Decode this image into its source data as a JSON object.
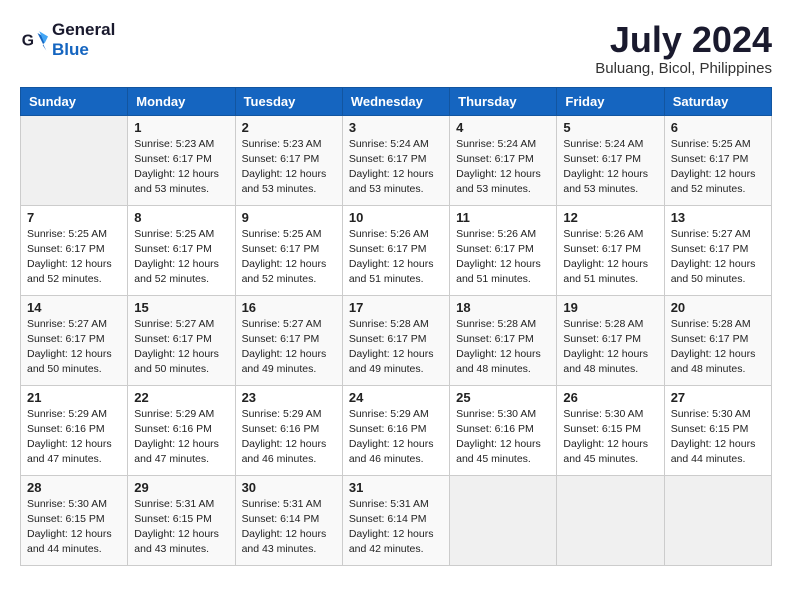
{
  "logo": {
    "line1": "General",
    "line2": "Blue"
  },
  "title": "July 2024",
  "location": "Buluang, Bicol, Philippines",
  "days_of_week": [
    "Sunday",
    "Monday",
    "Tuesday",
    "Wednesday",
    "Thursday",
    "Friday",
    "Saturday"
  ],
  "weeks": [
    [
      {
        "day": "",
        "info": ""
      },
      {
        "day": "1",
        "info": "Sunrise: 5:23 AM\nSunset: 6:17 PM\nDaylight: 12 hours\nand 53 minutes."
      },
      {
        "day": "2",
        "info": "Sunrise: 5:23 AM\nSunset: 6:17 PM\nDaylight: 12 hours\nand 53 minutes."
      },
      {
        "day": "3",
        "info": "Sunrise: 5:24 AM\nSunset: 6:17 PM\nDaylight: 12 hours\nand 53 minutes."
      },
      {
        "day": "4",
        "info": "Sunrise: 5:24 AM\nSunset: 6:17 PM\nDaylight: 12 hours\nand 53 minutes."
      },
      {
        "day": "5",
        "info": "Sunrise: 5:24 AM\nSunset: 6:17 PM\nDaylight: 12 hours\nand 53 minutes."
      },
      {
        "day": "6",
        "info": "Sunrise: 5:25 AM\nSunset: 6:17 PM\nDaylight: 12 hours\nand 52 minutes."
      }
    ],
    [
      {
        "day": "7",
        "info": "Sunrise: 5:25 AM\nSunset: 6:17 PM\nDaylight: 12 hours\nand 52 minutes."
      },
      {
        "day": "8",
        "info": "Sunrise: 5:25 AM\nSunset: 6:17 PM\nDaylight: 12 hours\nand 52 minutes."
      },
      {
        "day": "9",
        "info": "Sunrise: 5:25 AM\nSunset: 6:17 PM\nDaylight: 12 hours\nand 52 minutes."
      },
      {
        "day": "10",
        "info": "Sunrise: 5:26 AM\nSunset: 6:17 PM\nDaylight: 12 hours\nand 51 minutes."
      },
      {
        "day": "11",
        "info": "Sunrise: 5:26 AM\nSunset: 6:17 PM\nDaylight: 12 hours\nand 51 minutes."
      },
      {
        "day": "12",
        "info": "Sunrise: 5:26 AM\nSunset: 6:17 PM\nDaylight: 12 hours\nand 51 minutes."
      },
      {
        "day": "13",
        "info": "Sunrise: 5:27 AM\nSunset: 6:17 PM\nDaylight: 12 hours\nand 50 minutes."
      }
    ],
    [
      {
        "day": "14",
        "info": "Sunrise: 5:27 AM\nSunset: 6:17 PM\nDaylight: 12 hours\nand 50 minutes."
      },
      {
        "day": "15",
        "info": "Sunrise: 5:27 AM\nSunset: 6:17 PM\nDaylight: 12 hours\nand 50 minutes."
      },
      {
        "day": "16",
        "info": "Sunrise: 5:27 AM\nSunset: 6:17 PM\nDaylight: 12 hours\nand 49 minutes."
      },
      {
        "day": "17",
        "info": "Sunrise: 5:28 AM\nSunset: 6:17 PM\nDaylight: 12 hours\nand 49 minutes."
      },
      {
        "day": "18",
        "info": "Sunrise: 5:28 AM\nSunset: 6:17 PM\nDaylight: 12 hours\nand 48 minutes."
      },
      {
        "day": "19",
        "info": "Sunrise: 5:28 AM\nSunset: 6:17 PM\nDaylight: 12 hours\nand 48 minutes."
      },
      {
        "day": "20",
        "info": "Sunrise: 5:28 AM\nSunset: 6:17 PM\nDaylight: 12 hours\nand 48 minutes."
      }
    ],
    [
      {
        "day": "21",
        "info": "Sunrise: 5:29 AM\nSunset: 6:16 PM\nDaylight: 12 hours\nand 47 minutes."
      },
      {
        "day": "22",
        "info": "Sunrise: 5:29 AM\nSunset: 6:16 PM\nDaylight: 12 hours\nand 47 minutes."
      },
      {
        "day": "23",
        "info": "Sunrise: 5:29 AM\nSunset: 6:16 PM\nDaylight: 12 hours\nand 46 minutes."
      },
      {
        "day": "24",
        "info": "Sunrise: 5:29 AM\nSunset: 6:16 PM\nDaylight: 12 hours\nand 46 minutes."
      },
      {
        "day": "25",
        "info": "Sunrise: 5:30 AM\nSunset: 6:16 PM\nDaylight: 12 hours\nand 45 minutes."
      },
      {
        "day": "26",
        "info": "Sunrise: 5:30 AM\nSunset: 6:15 PM\nDaylight: 12 hours\nand 45 minutes."
      },
      {
        "day": "27",
        "info": "Sunrise: 5:30 AM\nSunset: 6:15 PM\nDaylight: 12 hours\nand 44 minutes."
      }
    ],
    [
      {
        "day": "28",
        "info": "Sunrise: 5:30 AM\nSunset: 6:15 PM\nDaylight: 12 hours\nand 44 minutes."
      },
      {
        "day": "29",
        "info": "Sunrise: 5:31 AM\nSunset: 6:15 PM\nDaylight: 12 hours\nand 43 minutes."
      },
      {
        "day": "30",
        "info": "Sunrise: 5:31 AM\nSunset: 6:14 PM\nDaylight: 12 hours\nand 43 minutes."
      },
      {
        "day": "31",
        "info": "Sunrise: 5:31 AM\nSunset: 6:14 PM\nDaylight: 12 hours\nand 42 minutes."
      },
      {
        "day": "",
        "info": ""
      },
      {
        "day": "",
        "info": ""
      },
      {
        "day": "",
        "info": ""
      }
    ]
  ]
}
